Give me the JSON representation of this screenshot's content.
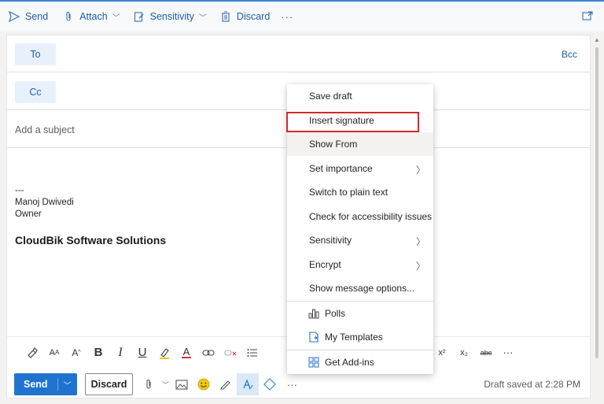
{
  "toolbar": {
    "send": "Send",
    "attach": "Attach",
    "sensitivity": "Sensitivity",
    "discard": "Discard",
    "more": "···"
  },
  "compose": {
    "to_label": "To",
    "cc_label": "Cc",
    "bcc_label": "Bcc",
    "subject_placeholder": "Add a subject",
    "signature": {
      "dashes": "---",
      "name": "Manoj Dwivedi",
      "title": "Owner",
      "company": "CloudBik Software Solutions"
    }
  },
  "context_menu": {
    "items": [
      {
        "label": "Save draft",
        "submenu": false
      },
      {
        "label": "Insert signature",
        "submenu": false
      },
      {
        "label": "Show From",
        "submenu": false
      },
      {
        "label": "Set importance",
        "submenu": true
      },
      {
        "label": "Switch to plain text",
        "submenu": false
      },
      {
        "label": "Check for accessibility issues",
        "submenu": false
      },
      {
        "label": "Sensitivity",
        "submenu": true
      },
      {
        "label": "Encrypt",
        "submenu": true
      },
      {
        "label": "Show message options...",
        "submenu": false
      },
      {
        "label": "Polls",
        "icon": "polls-icon"
      },
      {
        "label": "My Templates",
        "icon": "templates-icon"
      },
      {
        "label": "Get Add-ins",
        "icon": "add-ins-icon"
      }
    ]
  },
  "bottom": {
    "send": "Send",
    "discard": "Discard",
    "more": "···",
    "status": "Draft saved at 2:28 PM"
  },
  "format": {
    "bold": "B",
    "italic": "I",
    "underline": "U",
    "a_letter": "A",
    "superscript": "x²",
    "subscript": "x₂",
    "strike": "abc",
    "more": "···"
  },
  "colors": {
    "accent": "#1f73cf",
    "highlight_border": "#d62a2a"
  }
}
